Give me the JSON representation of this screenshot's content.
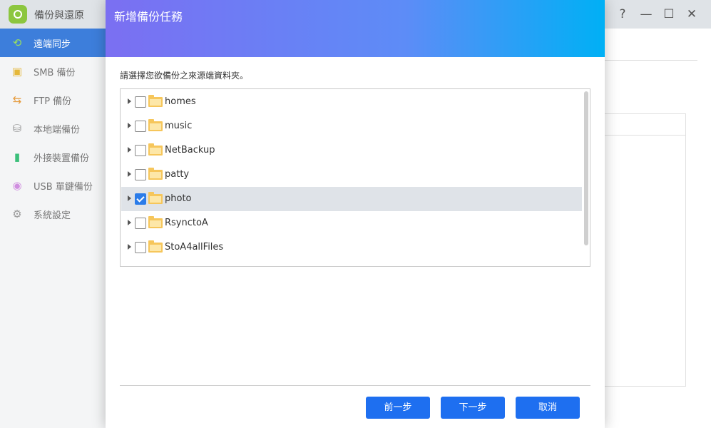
{
  "app": {
    "title": "備份與還原",
    "window_controls": [
      "?",
      "—",
      "☐",
      "✕"
    ]
  },
  "sidebar": {
    "items": [
      {
        "label": "遠端同步",
        "icon": "sync-icon",
        "active": true
      },
      {
        "label": "SMB 備份",
        "icon": "smb-icon",
        "active": false
      },
      {
        "label": "FTP 備份",
        "icon": "ftp-icon",
        "active": false
      },
      {
        "label": "本地端備份",
        "icon": "local-disk-icon",
        "active": false
      },
      {
        "label": "外接裝置備份",
        "icon": "external-device-icon",
        "active": false
      },
      {
        "label": "USB 單鍵備份",
        "icon": "usb-icon",
        "active": false
      },
      {
        "label": "系統設定",
        "icon": "gear-icon",
        "active": false
      }
    ]
  },
  "dialog": {
    "title": "新增備份任務",
    "instruction": "請選擇您欲備份之來源端資料夾。",
    "folders": [
      {
        "name": "homes",
        "checked": false,
        "selected": false
      },
      {
        "name": "music",
        "checked": false,
        "selected": false
      },
      {
        "name": "NetBackup",
        "checked": false,
        "selected": false
      },
      {
        "name": "patty",
        "checked": false,
        "selected": false
      },
      {
        "name": "photo",
        "checked": true,
        "selected": true
      },
      {
        "name": "RsynctoA",
        "checked": false,
        "selected": false
      },
      {
        "name": "StoA4allFiles",
        "checked": false,
        "selected": false
      }
    ],
    "buttons": {
      "prev": "前一步",
      "next": "下一步",
      "cancel": "取消"
    }
  },
  "colors": {
    "accent": "#1e6ff0",
    "sidebar_active": "#3d7edb",
    "header_gradient_start": "#7b6ff2",
    "header_gradient_end": "#00b0f5"
  }
}
